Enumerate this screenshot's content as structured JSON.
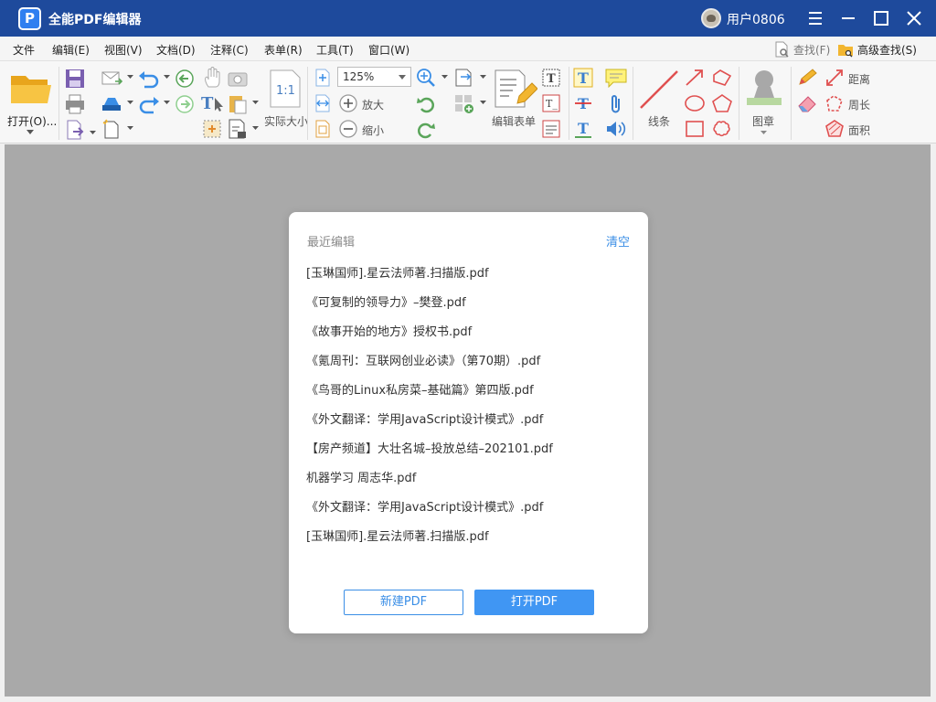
{
  "app": {
    "logo_letter": "P",
    "title": "全能PDF编辑器",
    "user_name": "用户0806"
  },
  "menu": {
    "items": [
      "文件",
      "编辑(E)",
      "视图(V)",
      "文档(D)",
      "注释(C)",
      "表单(R)",
      "工具(T)",
      "窗口(W)"
    ]
  },
  "find": {
    "find_label": "查找(F)",
    "advanced_label": "高级查找(S)"
  },
  "toolbar": {
    "open_label": "打开(O)...",
    "zoom_value": "125%",
    "actual_size_label": "实际大小",
    "zoom_in_label": "放大",
    "zoom_out_label": "缩小",
    "edit_form_label": "编辑表单",
    "lines_label": "线条",
    "stamp_label": "图章",
    "distance_label": "距离",
    "perimeter_label": "周长",
    "area_label": "面积"
  },
  "dialog": {
    "title": "最近编辑",
    "clear_label": "清空",
    "recent_files": [
      "[玉琳国师].星云法师著.扫描版.pdf",
      "《可复制的领导力》–樊登.pdf",
      "《故事开始的地方》授权书.pdf",
      "《氪周刊：互联网创业必读》（第70期）.pdf",
      "《鸟哥的Linux私房菜–基础篇》第四版.pdf",
      "《外文翻译：学用JavaScript设计模式》.pdf",
      "【房产频道】大壮名城–投放总结–202101.pdf",
      "机器学习 周志华.pdf",
      "《外文翻译：学用JavaScript设计模式》.pdf",
      "[玉琳国师].星云法师著.扫描版.pdf"
    ],
    "new_pdf_label": "新建PDF",
    "open_pdf_label": "打开PDF"
  },
  "colors": {
    "titlebar": "#1e4a9c",
    "accent": "#4096f3",
    "workspace": "#a9a9a9"
  }
}
